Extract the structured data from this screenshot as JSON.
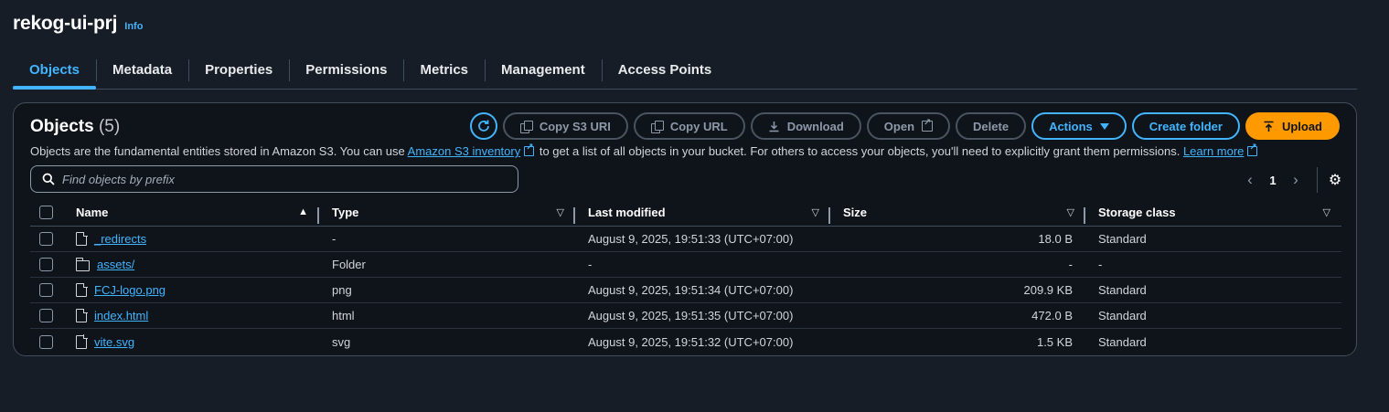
{
  "header": {
    "bucket_name": "rekog-ui-prj",
    "info_label": "Info"
  },
  "tabs": [
    {
      "label": "Objects",
      "active": true
    },
    {
      "label": "Metadata"
    },
    {
      "label": "Properties"
    },
    {
      "label": "Permissions"
    },
    {
      "label": "Metrics"
    },
    {
      "label": "Management"
    },
    {
      "label": "Access Points"
    }
  ],
  "objects_panel": {
    "title": "Objects",
    "count": "(5)",
    "description": {
      "part1": "Objects are the fundamental entities stored in Amazon S3. You can use ",
      "inventory_link": "Amazon S3 inventory",
      "part2": " to get a list of all objects in your bucket. For others to access your objects, you'll need to explicitly grant them permissions. ",
      "learn_more_link": "Learn more"
    },
    "toolbar": {
      "refresh_icon": "refresh-icon",
      "copy_s3_uri": "Copy S3 URI",
      "copy_url": "Copy URL",
      "download": "Download",
      "open": "Open",
      "delete": "Delete",
      "actions": "Actions",
      "create_folder": "Create folder",
      "upload": "Upload"
    },
    "search": {
      "placeholder": "Find objects by prefix",
      "value": ""
    },
    "pagination": {
      "current_page": "1",
      "prev": "‹",
      "next": "›"
    },
    "columns": {
      "name": "Name",
      "type": "Type",
      "last_modified": "Last modified",
      "size": "Size",
      "storage_class": "Storage class"
    },
    "rows": [
      {
        "icon": "file-icon",
        "name": "_redirects",
        "type": "-",
        "last_modified": "August 9, 2025, 19:51:33 (UTC+07:00)",
        "size": "18.0 B",
        "storage_class": "Standard"
      },
      {
        "icon": "folder-icon",
        "name": "assets/",
        "type": "Folder",
        "last_modified": "-",
        "size": "-",
        "storage_class": "-"
      },
      {
        "icon": "file-icon",
        "name": "FCJ-logo.png",
        "type": "png",
        "last_modified": "August 9, 2025, 19:51:34 (UTC+07:00)",
        "size": "209.9 KB",
        "storage_class": "Standard"
      },
      {
        "icon": "file-icon",
        "name": "index.html",
        "type": "html",
        "last_modified": "August 9, 2025, 19:51:35 (UTC+07:00)",
        "size": "472.0 B",
        "storage_class": "Standard"
      },
      {
        "icon": "file-icon",
        "name": "vite.svg",
        "type": "svg",
        "last_modified": "August 9, 2025, 19:51:32 (UTC+07:00)",
        "size": "1.5 KB",
        "storage_class": "Standard"
      }
    ]
  },
  "colors": {
    "background": "#161d26",
    "panel": "#0f141a",
    "accent": "#42b4ff",
    "upload": "#ff9900"
  }
}
